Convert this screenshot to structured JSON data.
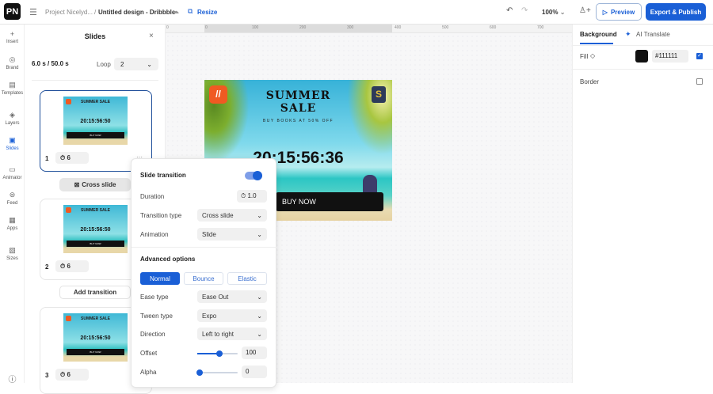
{
  "header": {
    "logo": "PN",
    "project": "Project Nicelyd...",
    "separator": "/",
    "design_title": "Untitled design - Dribbble",
    "resize": "Resize",
    "zoom": "100%",
    "preview": "Preview",
    "export": "Export & Publish"
  },
  "rail": [
    {
      "label": "Insert",
      "icon": "+"
    },
    {
      "label": "Brand",
      "icon": "◎"
    },
    {
      "label": "Templates",
      "icon": "▤"
    },
    {
      "label": "Layers",
      "icon": "◈"
    },
    {
      "label": "Slides",
      "icon": "▣"
    },
    {
      "label": "Animator",
      "icon": "▭"
    },
    {
      "label": "Feed",
      "icon": "⊜"
    },
    {
      "label": "Apps",
      "icon": "▦"
    },
    {
      "label": "Sizes",
      "icon": "▧"
    }
  ],
  "slides_panel": {
    "title": "Slides",
    "time": "6.0 s / 50.0 s",
    "loop_label": "Loop",
    "loop_value": "2",
    "transition_label": "Cross slide",
    "add_transition": "Add transition",
    "slides": [
      {
        "num": "1",
        "duration": "6"
      },
      {
        "num": "2",
        "duration": "6"
      },
      {
        "num": "3",
        "duration": "6"
      }
    ],
    "thumb": {
      "title": "SUMMER SALE",
      "timer": "20:15:56:50",
      "cta": "BUY NOW"
    }
  },
  "ruler": [
    "0",
    "0",
    "100",
    "200",
    "300",
    "400",
    "500",
    "600",
    "700"
  ],
  "banner": {
    "title1": "SUMMER",
    "title2": "SALE",
    "subtitle": "BUY BOOKS AT 50% OFF",
    "timer": "20:15:56:36",
    "cta": "BUY NOW"
  },
  "right_panel": {
    "tab_background": "Background",
    "tab_translate": "AI Translate",
    "fill_label": "Fill",
    "fill_value": "#111111",
    "fill_color": "#111111",
    "border_label": "Border"
  },
  "transition": {
    "title": "Slide transition",
    "enabled": true,
    "duration_label": "Duration",
    "duration": "1.0",
    "type_label": "Transition type",
    "type": "Cross slide",
    "animation_label": "Animation",
    "animation": "Slide",
    "advanced": "Advanced options",
    "modes": [
      "Normal",
      "Bounce",
      "Elastic"
    ],
    "ease_label": "Ease type",
    "ease": "Ease Out",
    "tween_label": "Tween type",
    "tween": "Expo",
    "direction_label": "Direction",
    "direction": "Left to right",
    "offset_label": "Offset",
    "offset": "100",
    "alpha_label": "Alpha",
    "alpha": "0",
    "offset_fraction": 0.55,
    "alpha_fraction": 0.0
  },
  "colors": {
    "accent": "#1a5fd6"
  }
}
